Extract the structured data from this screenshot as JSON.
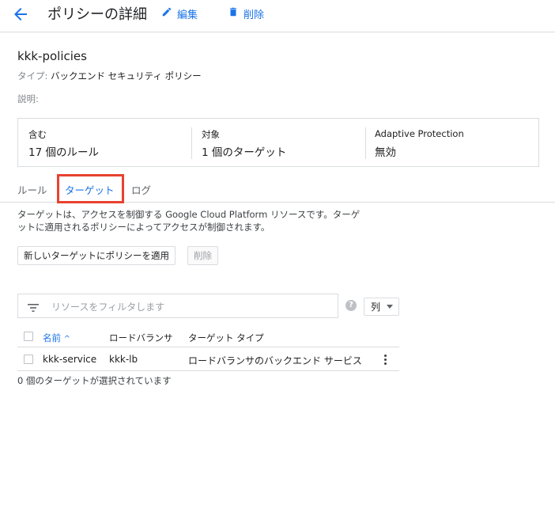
{
  "header": {
    "title": "ポリシーの詳細",
    "edit_label": "編集",
    "delete_label": "削除"
  },
  "policy": {
    "name": "kkk-policies",
    "type_label": "タイプ:",
    "type_value": "バックエンド セキュリティ ポリシー",
    "description_label": "説明:"
  },
  "summary": {
    "includes_label": "含む",
    "includes_value": "17 個のルール",
    "targets_label": "対象",
    "targets_value": "1 個のターゲット",
    "adaptive_label": "Adaptive Protection",
    "adaptive_value": "無効"
  },
  "tabs": [
    {
      "label": "ルール"
    },
    {
      "label": "ターゲット"
    },
    {
      "label": "ログ"
    }
  ],
  "active_tab": "ターゲット",
  "info": {
    "line1": "ターゲットは、アクセスを制御する Google Cloud Platform リソースです。ターゲ",
    "line2": "ットに適用されるポリシーによってアクセスが制御されます。"
  },
  "actions": {
    "apply_label": "新しいターゲットにポリシーを適用",
    "delete_label": "削除"
  },
  "filter": {
    "placeholder": "リソースをフィルタします",
    "help_icon": "?",
    "columns_label": "列"
  },
  "table": {
    "headers": {
      "name": "名前",
      "sort_indicator": "^",
      "load_balancer": "ロードバランサ",
      "target_type": "ターゲット タイプ"
    },
    "rows": [
      {
        "name": "kkk-service",
        "load_balancer": "kkk-lb",
        "target_type": "ロードバランサのバックエンド サービス"
      }
    ],
    "selected_count": "0 個のターゲットが選択されています"
  },
  "colors": {
    "accent": "#1a73e8",
    "highlight": "#e8422f",
    "border": "#dadce0"
  }
}
